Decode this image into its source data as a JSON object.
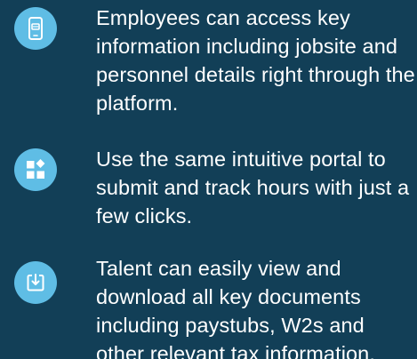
{
  "colors": {
    "background": "#123f57",
    "icon_circle": "#5fbde5",
    "text": "#ffffff"
  },
  "features": [
    {
      "icon": "mobile-chat-icon",
      "text": "Employees can access key information including jobsite and personnel details right through the platform."
    },
    {
      "icon": "apps-grid-icon",
      "text": "Use the same intuitive portal to submit and track hours with just a few clicks."
    },
    {
      "icon": "download-document-icon",
      "text": "Talent can easily view and download all key documents including paystubs, W2s and other relevant tax information."
    }
  ]
}
